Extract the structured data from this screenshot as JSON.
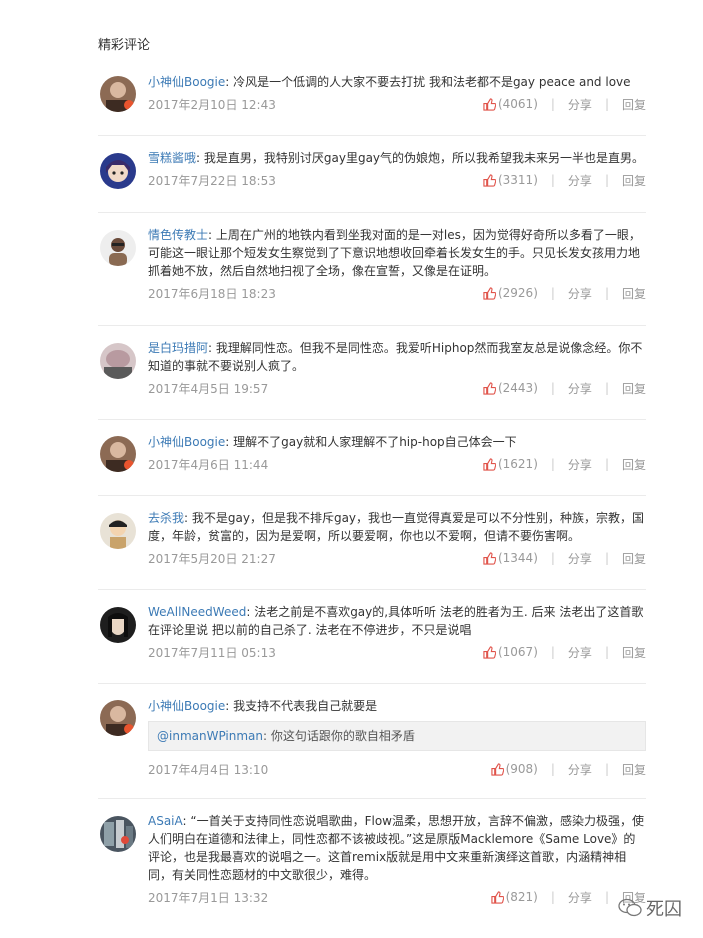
{
  "section_title": "精彩评论",
  "actions": {
    "share": "分享",
    "reply": "回复"
  },
  "comments": [
    {
      "user": "小神仙Boogie",
      "text": "冷风是一个低调的人大家不要去打扰 我和法老都不是gay peace and love",
      "time": "2017年2月10日 12:43",
      "likes": "(4061)"
    },
    {
      "user": "雪糕酱哦",
      "text": "我是直男，我特别讨厌gay里gay气的伪娘炮，所以我希望我未来另一半也是直男。",
      "time": "2017年7月22日 18:53",
      "likes": "(3311)"
    },
    {
      "user": "情色传教士",
      "text": "上周在广州的地铁内看到坐我对面的是一对les，因为觉得好奇所以多看了一眼，可能这一眼让那个短发女生察觉到了下意识地想收回牵着长发女生的手。只见长发女孩用力地抓着她不放，然后自然地扫视了全场，像在宣誓，又像是在证明。",
      "time": "2017年6月18日 18:23",
      "likes": "(2926)"
    },
    {
      "user": "是白玛措阿",
      "text": "我理解同性恋。但我不是同性恋。我爱听Hiphop然而我室友总是说像念经。你不知道的事就不要说别人疯了。",
      "time": "2017年4月5日 19:57",
      "likes": "(2443)"
    },
    {
      "user": "小神仙Boogie",
      "text": "理解不了gay就和人家理解不了hip-hop自己体会一下",
      "time": "2017年4月6日 11:44",
      "likes": "(1621)"
    },
    {
      "user": "去杀我",
      "text": "我不是gay，但是我不排斥gay，我也一直觉得真爱是可以不分性别，种族，宗教，国度，年龄，贫富的，因为是爱啊，所以要爱啊，你也以不爱啊，但请不要伤害啊。",
      "time": "2017年5月20日 21:27",
      "likes": "(1344)"
    },
    {
      "user": "WeAllNeedWeed",
      "text": "法老之前是不喜欢gay的,具体听听 法老的胜者为王. 后来 法老出了这首歌 在评论里说 把以前的自己杀了. 法老在不停进步，不只是说唱",
      "time": "2017年7月11日 05:13",
      "likes": "(1067)"
    },
    {
      "user": "小神仙Boogie",
      "text": "我支持不代表我自己就要是",
      "quote_user": "@inmanWPinman",
      "quote_text": "你这句话跟你的歌自相矛盾",
      "time": "2017年4月4日 13:10",
      "likes": "(908)"
    },
    {
      "user": "ASaiA",
      "text": "“一首关于支持同性恋说唱歌曲，Flow温柔，思想开放，言辞不偏激，感染力极强，使人们明白在道德和法律上，同性恋都不该被歧视。”这是原版Macklemore《Same Love》的评论，也是我最喜欢的说唱之一。这首remix版就是用中文来重新演绎这首歌，内涵精神相同，有关同性恋题材的中文歌很少，难得。",
      "time": "2017年7月1日 13:32",
      "likes": "(821)"
    }
  ],
  "watermark": "死囚"
}
